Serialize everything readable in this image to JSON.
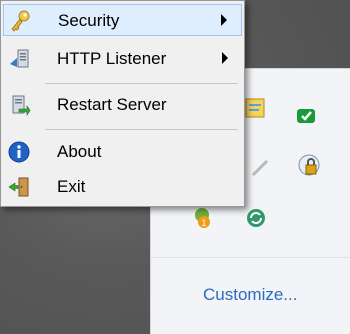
{
  "context_menu": {
    "items": [
      {
        "label": "Security",
        "icon": "key-icon",
        "has_submenu": true,
        "highlighted": true
      },
      {
        "label": "HTTP Listener",
        "icon": "network-server-icon",
        "has_submenu": true
      },
      {
        "label": "Restart Server",
        "icon": "restart-icon",
        "has_submenu": false
      },
      {
        "label": "About",
        "icon": "info-icon",
        "has_submenu": false
      },
      {
        "label": "Exit",
        "icon": "exit-door-icon",
        "has_submenu": false
      }
    ]
  },
  "tray_overflow": {
    "customize_label": "Customize...",
    "icons": [
      "notes-icon",
      "cloud-sync-icon",
      "pen-icon",
      "lock-icon",
      "notification-badge-icon",
      "refresh-globe-icon"
    ],
    "badge_count": "1"
  },
  "colors": {
    "highlight": "#dfeeff",
    "link": "#2a6cbf",
    "menu_bg": "#f0f0f0"
  }
}
